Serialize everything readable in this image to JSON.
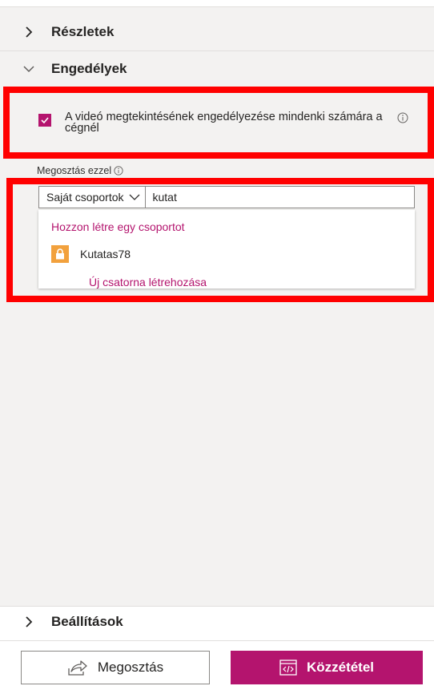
{
  "sections": {
    "details": {
      "label": "Részletek",
      "icon": "chevron-right-icon"
    },
    "permissions": {
      "label": "Engedélyek",
      "icon": "chevron-down-icon"
    },
    "settings": {
      "label": "Beállítások",
      "icon": "chevron-right-icon"
    }
  },
  "permissions": {
    "allow_company_checkbox": {
      "checked": true,
      "label": "A videó megtekintésének engedélyezése mindenki számára a cégnél"
    },
    "share_with": {
      "label": "Megosztás ezzel",
      "scope_select_value": "Saját csoportok",
      "search_value": "kutat"
    },
    "suggestions": {
      "create_group_link": "Hozzon létre egy csoportot",
      "group_item": "Kutatas78",
      "create_channel_link": "Új csatorna létrehozása"
    }
  },
  "footer": {
    "share_button": "Megosztás",
    "publish_button": "Közzététel"
  },
  "colors": {
    "accent": "#b4146e",
    "highlight_box": "#ff0000",
    "group_tile": "#f2a13d"
  }
}
